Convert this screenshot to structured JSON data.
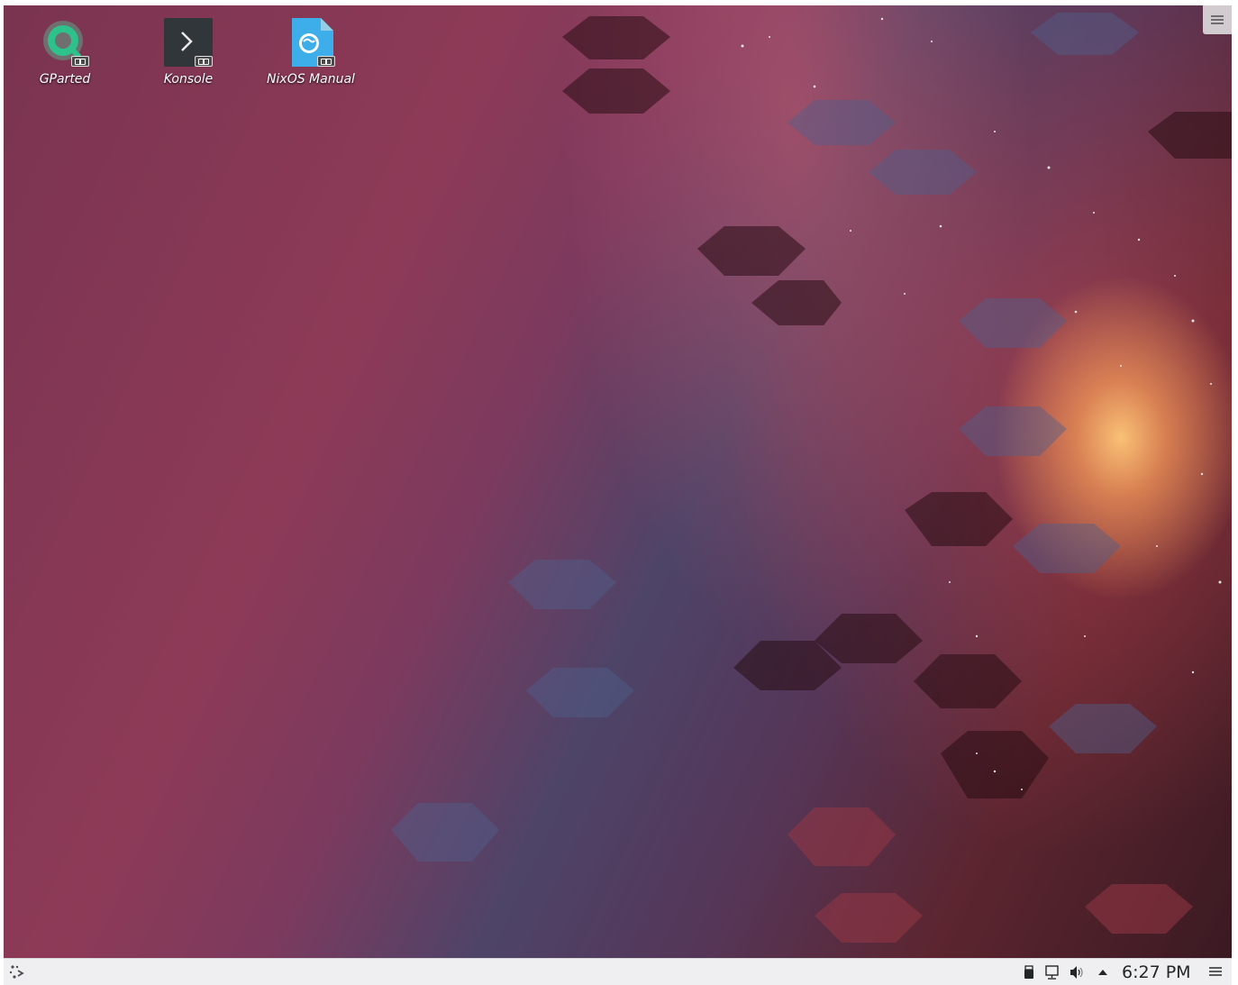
{
  "desktop": {
    "icons": [
      {
        "label": "GParted",
        "icon": "gparted-icon"
      },
      {
        "label": "Konsole",
        "icon": "konsole-icon"
      },
      {
        "label": "NixOS Manual",
        "icon": "nixos-manual-icon"
      }
    ],
    "toolbox_icon": "hamburger-menu-icon"
  },
  "panel": {
    "launcher_icon": "application-launcher-icon",
    "tray": [
      {
        "icon": "usb-device-icon"
      },
      {
        "icon": "network-wired-icon"
      },
      {
        "icon": "volume-icon"
      },
      {
        "icon": "expand-arrow-icon"
      }
    ],
    "clock": "6:27 PM",
    "panel_menu_icon": "hamburger-menu-icon"
  },
  "colors": {
    "panel_bg": "#efeff1",
    "gparted_green": "#2ec18c",
    "konsole_bg": "#31363b",
    "nixos_blue": "#3daee9"
  }
}
